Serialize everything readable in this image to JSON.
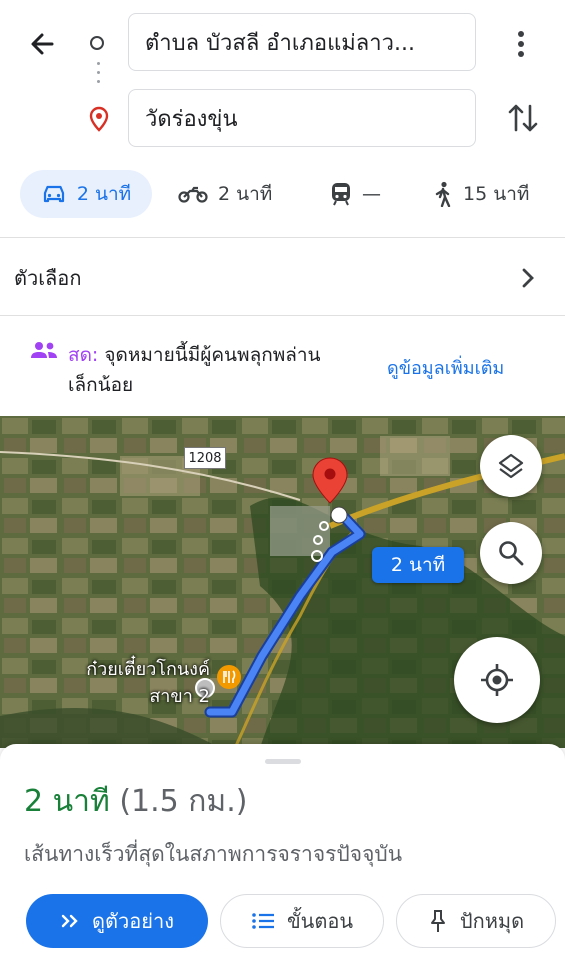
{
  "header": {
    "origin": "ตำบล บัวสลี อำเภอแม่ลาว...",
    "destination": "วัดร่องขุ่น"
  },
  "modes": [
    {
      "name": "car-icon",
      "label": "2 นาที",
      "selected": true
    },
    {
      "name": "motorcycle-icon",
      "label": "2 นาที"
    },
    {
      "name": "transit-icon",
      "label": "—"
    },
    {
      "name": "walk-icon",
      "label": "15 นาที"
    }
  ],
  "options_label": "ตัวเลือก",
  "live": {
    "label": "สด:",
    "text": " จุดหมายนี้มีผู้คนพลุกพล่านเล็กน้อย",
    "link": "ดูข้อมูลเพิ่มเติม"
  },
  "map": {
    "road_number": "1208",
    "eta_bubble": "2 นาที",
    "place_name": "ก๋วยเตี๋ยวโกนงค์ สาขา 2"
  },
  "route": {
    "duration": "2 นาที",
    "distance": "(1.5 กม.)",
    "description": "เส้นทางเร็วที่สุดในสภาพการจราจรปัจจุบัน"
  },
  "actions": {
    "preview": "ดูตัวอย่าง",
    "steps": "ขั้นตอน",
    "pin": "ปักหมุด"
  },
  "colors": {
    "accent": "#1a73e8",
    "duration": "#188038",
    "live": "#a142f4",
    "pin": "#ea4335"
  }
}
